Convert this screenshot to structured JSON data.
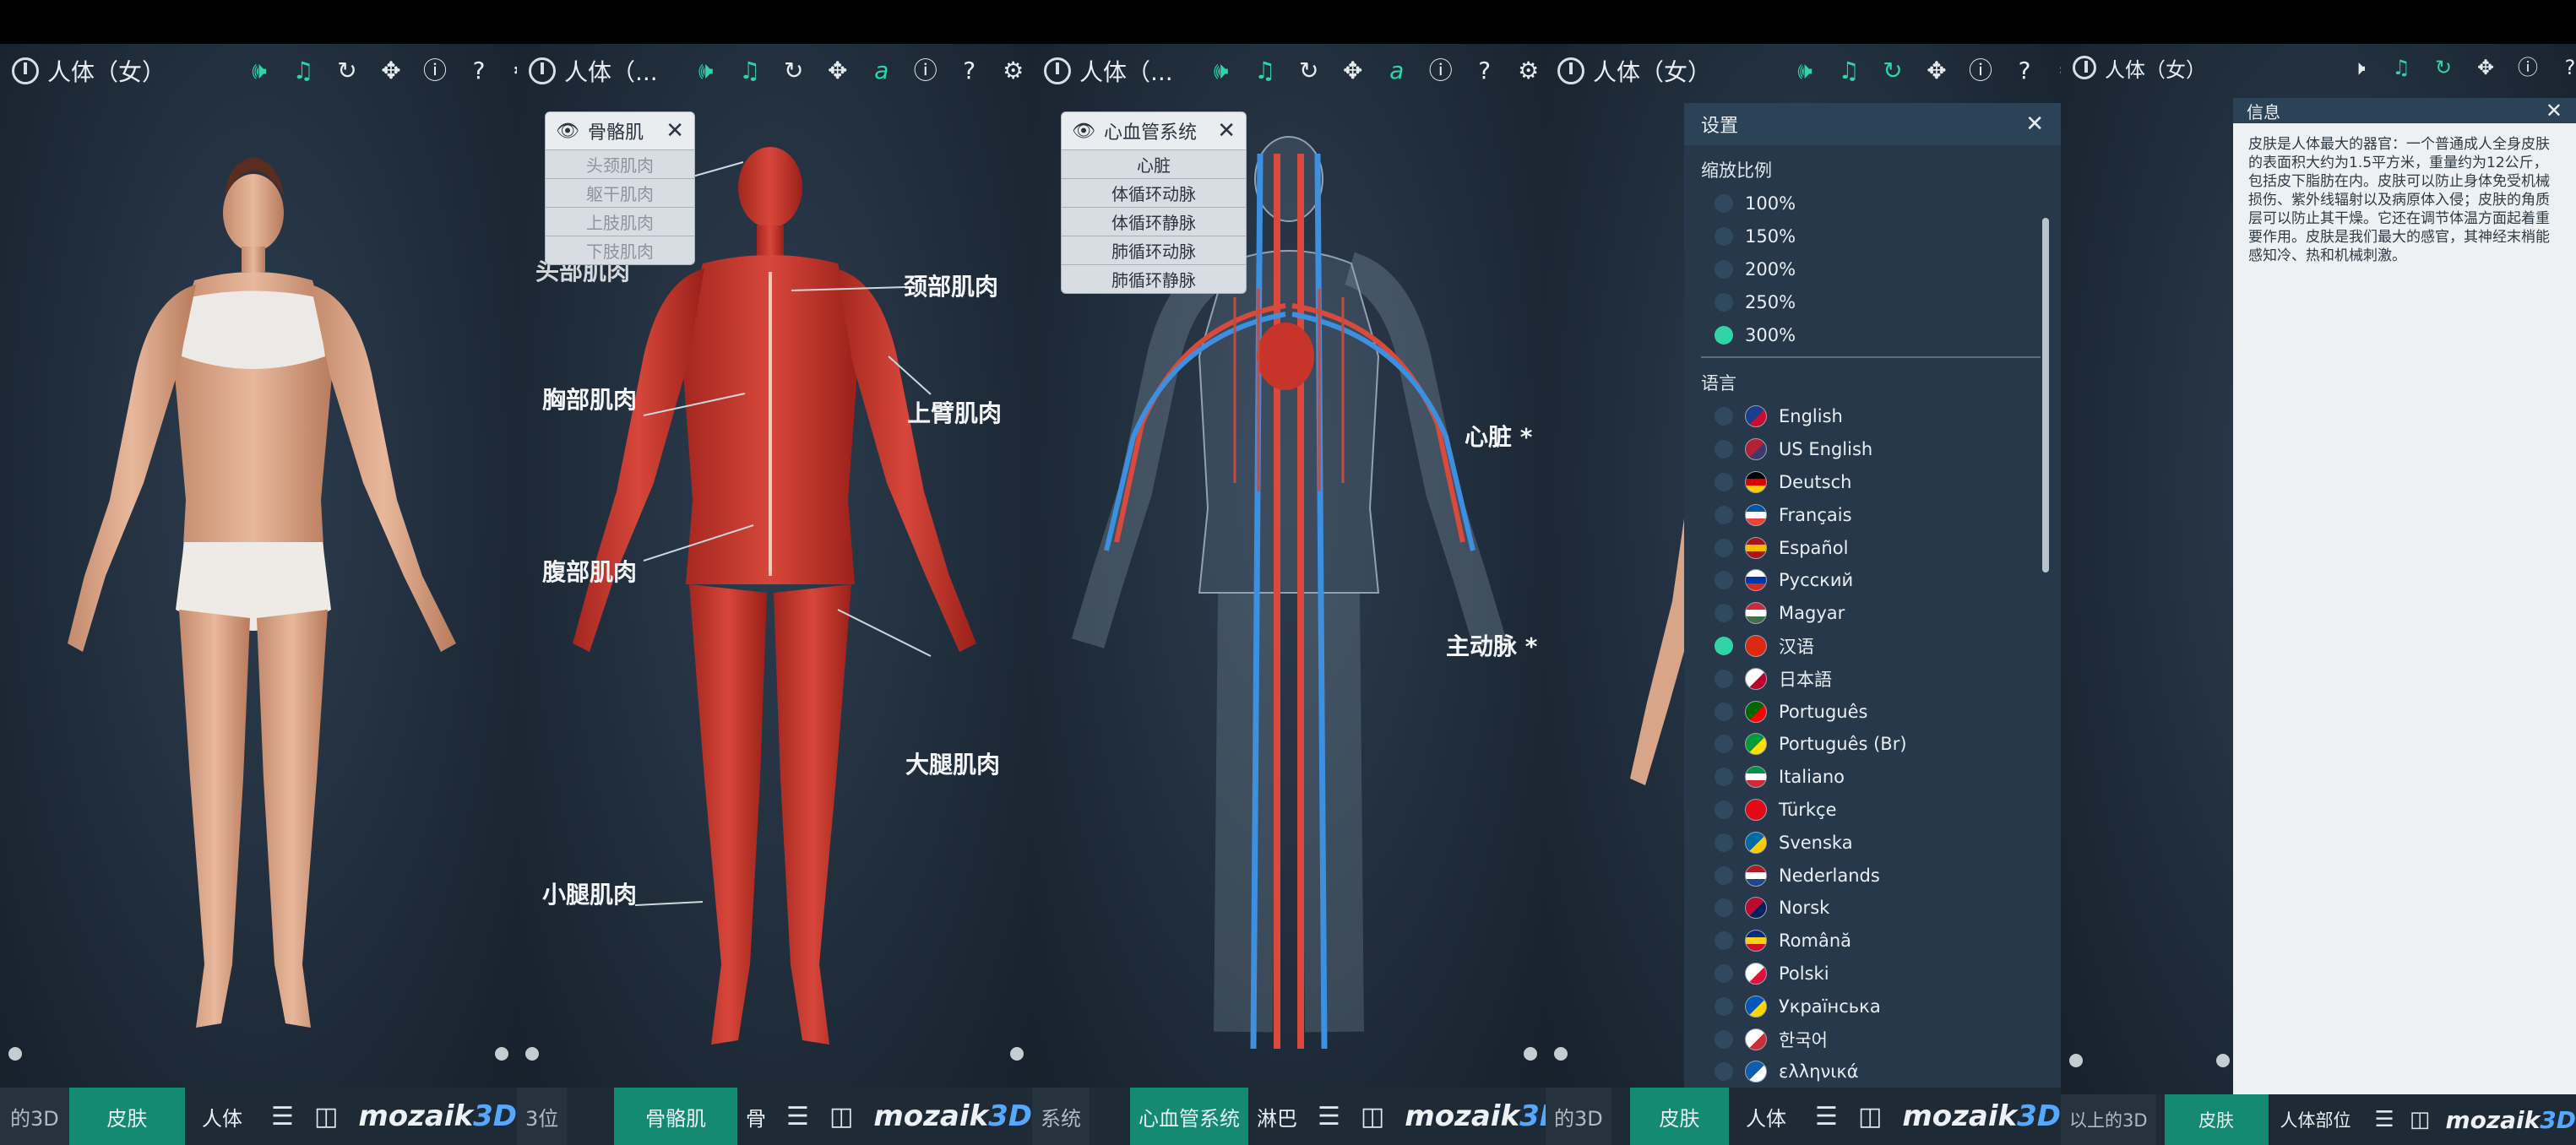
{
  "panels": [
    {
      "title": "人体（女）",
      "skin_tab": "皮肤",
      "left_tab_fragment": "的3D",
      "right_tab_fragment": "人体"
    },
    {
      "title": "人体（...",
      "skin_tab": "骨骼肌",
      "left_tab_fragment": "3位",
      "right_tab_fragment": "骨"
    },
    {
      "title": "人体（...",
      "skin_tab": "心血管系统",
      "left_tab_fragment": "系统",
      "right_tab_fragment": "淋巴"
    },
    {
      "title": "人体（女）",
      "skin_tab": "皮肤",
      "left_tab_fragment": "的3D",
      "right_tab_fragment": "人体"
    },
    {
      "title": "人体（女）",
      "skin_tab": "皮肤",
      "left_tab_fragment": "以上的3D",
      "right_tab_fragment": "人体部位"
    }
  ],
  "logo_main": "mozaik",
  "logo_accent": "3D",
  "muscle_popup": {
    "title": "骨骼肌",
    "items": [
      "头颈肌肉",
      "躯干肌肉",
      "上肢肌肉",
      "下肢肌肉"
    ]
  },
  "muscle_labels": {
    "neck": "颈部肌肉",
    "chest": "胸部肌肉",
    "upper_arm": "上臂肌肉",
    "abdomen": "腹部肌肉",
    "thigh": "大腿肌肉",
    "calf": "小腿肌肉",
    "head_partial": "头部肌肉"
  },
  "cardio_popup": {
    "title": "心血管系统",
    "items": [
      "心脏",
      "体循环动脉",
      "体循环静脉",
      "肺循环动脉",
      "肺循环静脉"
    ]
  },
  "cardio_labels": {
    "heart": "心脏 *",
    "aorta": "主动脉 *"
  },
  "settings": {
    "title": "设置",
    "zoom_heading": "缩放比例",
    "zoom_options": [
      "100%",
      "150%",
      "200%",
      "250%",
      "300%"
    ],
    "zoom_selected": "300%",
    "language_heading": "语言",
    "languages": [
      {
        "name": "English",
        "colors": [
          "#1a3d8f",
          "#c8102e"
        ]
      },
      {
        "name": "US English",
        "colors": [
          "#b22234",
          "#3c3b6e"
        ]
      },
      {
        "name": "Deutsch",
        "colors": [
          "#000000",
          "#dd0000",
          "#ffce00"
        ]
      },
      {
        "name": "Français",
        "colors": [
          "#0055a4",
          "#ffffff",
          "#ef4135"
        ]
      },
      {
        "name": "Español",
        "colors": [
          "#aa151b",
          "#f1bf00",
          "#aa151b"
        ]
      },
      {
        "name": "Русский",
        "colors": [
          "#ffffff",
          "#0039a6",
          "#d52b1e"
        ]
      },
      {
        "name": "Magyar",
        "colors": [
          "#cd2a3e",
          "#ffffff",
          "#436f4d"
        ]
      },
      {
        "name": "汉语",
        "colors": [
          "#de2910",
          "#de2910"
        ]
      },
      {
        "name": "日本語",
        "colors": [
          "#ffffff",
          "#bc002d"
        ]
      },
      {
        "name": "Português",
        "colors": [
          "#006600",
          "#ff0000"
        ]
      },
      {
        "name": "Português (Br)",
        "colors": [
          "#009c3b",
          "#ffdf00"
        ]
      },
      {
        "name": "Italiano",
        "colors": [
          "#009246",
          "#ffffff",
          "#ce2b37"
        ]
      },
      {
        "name": "Türkçe",
        "colors": [
          "#e30a17",
          "#e30a17"
        ]
      },
      {
        "name": "Svenska",
        "colors": [
          "#006aa7",
          "#fecc00"
        ]
      },
      {
        "name": "Nederlands",
        "colors": [
          "#ae1c28",
          "#ffffff",
          "#21468b"
        ]
      },
      {
        "name": "Norsk",
        "colors": [
          "#ba0c2f",
          "#00205b"
        ]
      },
      {
        "name": "Română",
        "colors": [
          "#002b7f",
          "#fcd116",
          "#ce1126"
        ]
      },
      {
        "name": "Polski",
        "colors": [
          "#ffffff",
          "#dc143c"
        ]
      },
      {
        "name": "Українська",
        "colors": [
          "#0057b7",
          "#ffd700"
        ]
      },
      {
        "name": "한국어",
        "colors": [
          "#ffffff",
          "#cd2e3a"
        ]
      },
      {
        "name": "ελληνικά",
        "colors": [
          "#0d5eaf",
          "#ffffff"
        ]
      }
    ],
    "language_selected": "汉语"
  },
  "info": {
    "title": "信息",
    "text": "皮肤是人体最大的器官：一个普通成人全身皮肤的表面积大约为1.5平方米，重量约为12公斤，包括皮下脂肪在内。皮肤可以防止身体免受机械损伤、紫外线辐射以及病原体入侵；皮肤的角质层可以防止其干燥。它还在调节体温方面起着重要作用。皮肤是我们最大的感官，其神经末梢能感知冷、热和机械刺激。"
  },
  "colors": {
    "accent": "#2fd4a8",
    "tab_active": "#148a72",
    "panel_bg": "#1c2835",
    "logo_accent": "#56a8ff"
  }
}
